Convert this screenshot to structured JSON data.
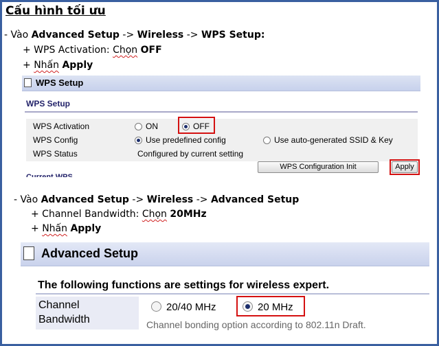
{
  "doc": {
    "title": "Cấu hình tối ưu",
    "step1": {
      "prefix": "- Vào ",
      "path": [
        "Advanced Setup",
        "Wireless",
        "WPS Setup:"
      ],
      "arrow": " -> ",
      "sub1_prefix": "+ WPS Activation: ",
      "sub1_verb": "Chọn",
      "sub1_value": "OFF",
      "sub2_prefix": "+ ",
      "sub2_verb": "Nhấn",
      "sub2_value": "Apply"
    },
    "step2": {
      "prefix": "- Vào ",
      "path": [
        "Advanced Setup",
        "Wireless",
        "Advanced Setup"
      ],
      "arrow": " -> ",
      "sub1_prefix": "+ Channel Bandwidth: ",
      "sub1_verb": "Chọn",
      "sub1_value": "20MHz",
      "sub2_prefix": "+ ",
      "sub2_verb": "Nhấn",
      "sub2_value": "Apply"
    }
  },
  "wps_panel": {
    "header": "WPS Setup",
    "section": "WPS Setup",
    "rows": [
      {
        "label": "WPS Activation",
        "options": [
          "ON",
          "OFF"
        ],
        "selected": "OFF"
      },
      {
        "label": "WPS Config",
        "options": [
          "Use predefined config",
          "Use auto-generated SSID & Key"
        ],
        "selected": "Use predefined config"
      },
      {
        "label": "WPS Status",
        "value": "Configured by current setting"
      }
    ],
    "init_button": "WPS Configuration Init",
    "apply_button": "Apply",
    "cut_section": "Current WPS"
  },
  "adv_panel": {
    "header": "Advanced Setup",
    "description": "The following functions are settings for wireless expert.",
    "bandwidth_label_1": "Channel",
    "bandwidth_label_2": "Bandwidth",
    "options": [
      "20/40 MHz",
      "20 MHz"
    ],
    "selected": "20 MHz",
    "hint": "Channel bonding option according to 802.11n Draft."
  },
  "colors": {
    "frame": "#3a5fa0",
    "highlight": "#d41010",
    "header_bg": "#c7d1ec",
    "radio_fill": "#1b2d6b"
  }
}
